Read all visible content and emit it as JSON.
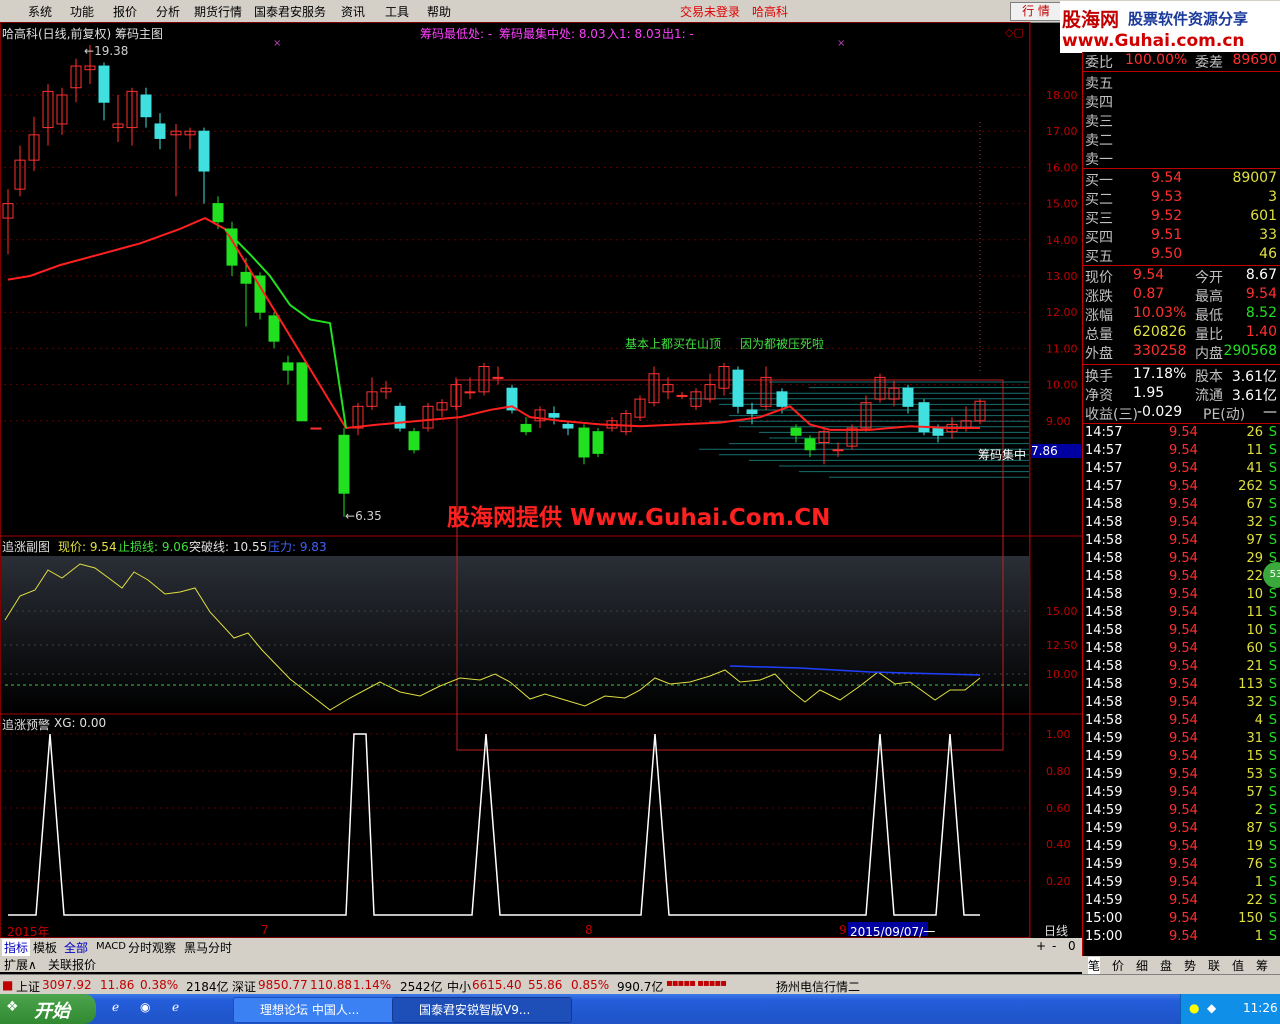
{
  "menu": {
    "items": [
      "系统",
      "功能",
      "报价",
      "分析",
      "期货行情",
      "国泰君安服务",
      "资讯",
      "工具",
      "帮助"
    ],
    "warn_login": "交易未登录",
    "stock_name": "哈高科",
    "btn_hq": "行 情"
  },
  "logo": {
    "title": "股海网",
    "subtitle": "股票软件资源分享",
    "url": "www.Guhai.com.cn"
  },
  "main": {
    "title": "哈高科(日线,前复权) 筹码主图",
    "chip_low": "筹码最低处: -",
    "chip_mid": "筹码最集中处: 8.03",
    "chip_in": "入1: 8.03",
    "chip_out": "出1: -",
    "high_label": "19.38",
    "low_label": "6.35",
    "note1": "基本上都买在山顶",
    "note2": "因为都被压死啦",
    "watermark": "股海网提供 Www.Guhai.Com.CN",
    "chip_center": "筹码集中",
    "chip_center_val": "7.86",
    "yticks": [
      "18.00",
      "17.00",
      "16.00",
      "15.00",
      "14.00",
      "13.00",
      "12.00",
      "11.00",
      "10.00",
      "9.00"
    ]
  },
  "sub1": {
    "title": "追涨副图",
    "price": "现价: 9.54",
    "stop": "止损线: 9.06",
    "breakout": "突破线: 10.55",
    "pressure": "压力: 9.83",
    "yticks": [
      "15.00",
      "12.50",
      "10.00"
    ]
  },
  "sub2": {
    "title": "追涨预警",
    "xg": "XG: 0.00",
    "yticks": [
      "1.00",
      "0.80",
      "0.60",
      "0.40",
      "0.20"
    ]
  },
  "xaxis": {
    "labels": [
      "2015年",
      "7",
      "8",
      "9"
    ],
    "cursor_date": "2015/09/07/一",
    "period": "日线"
  },
  "tabs": [
    "指标",
    "模板",
    "全部",
    "MACD",
    "分时观察",
    "黑马分时"
  ],
  "ext": [
    "扩展∧",
    "关联报价"
  ],
  "order": {
    "ratio_label": "委比",
    "ratio_val": "100.00%",
    "diff_label": "委差",
    "diff_val": "89690",
    "sells": [
      "卖五",
      "卖四",
      "卖三",
      "卖二",
      "卖一"
    ],
    "buys": [
      {
        "name": "买一",
        "price": "9.54",
        "vol": "89007"
      },
      {
        "name": "买二",
        "price": "9.53",
        "vol": "3"
      },
      {
        "name": "买三",
        "price": "9.52",
        "vol": "601"
      },
      {
        "name": "买四",
        "price": "9.51",
        "vol": "33"
      },
      {
        "name": "买五",
        "price": "9.50",
        "vol": "46"
      }
    ]
  },
  "quote": [
    {
      "l": "现价",
      "v": "9.54",
      "l2": "今开",
      "v2": "8.67"
    },
    {
      "l": "涨跌",
      "v": "0.87",
      "l2": "最高",
      "v2": "9.54"
    },
    {
      "l": "涨幅",
      "v": "10.03%",
      "l2": "最低",
      "v2": "8.52"
    },
    {
      "l": "总量",
      "v": "620826",
      "l2": "量比",
      "v2": "1.40"
    },
    {
      "l": "外盘",
      "v": "330258",
      "l2": "内盘",
      "v2": "290568"
    }
  ],
  "fund": [
    {
      "l": "换手",
      "v": "17.18%",
      "l2": "股本",
      "v2": "3.61亿"
    },
    {
      "l": "净资",
      "v": "1.95",
      "l2": "流通",
      "v2": "3.61亿"
    },
    {
      "l": "收益(三)",
      "v": "-0.029",
      "l2": "PE(动)",
      "v2": "—"
    }
  ],
  "ticks": [
    {
      "t": "14:57",
      "p": "9.54",
      "v": "26"
    },
    {
      "t": "14:57",
      "p": "9.54",
      "v": "11"
    },
    {
      "t": "14:57",
      "p": "9.54",
      "v": "41"
    },
    {
      "t": "14:57",
      "p": "9.54",
      "v": "262"
    },
    {
      "t": "14:58",
      "p": "9.54",
      "v": "67"
    },
    {
      "t": "14:58",
      "p": "9.54",
      "v": "32"
    },
    {
      "t": "14:58",
      "p": "9.54",
      "v": "97"
    },
    {
      "t": "14:58",
      "p": "9.54",
      "v": "29"
    },
    {
      "t": "14:58",
      "p": "9.54",
      "v": "22"
    },
    {
      "t": "14:58",
      "p": "9.54",
      "v": "10"
    },
    {
      "t": "14:58",
      "p": "9.54",
      "v": "11"
    },
    {
      "t": "14:58",
      "p": "9.54",
      "v": "10"
    },
    {
      "t": "14:58",
      "p": "9.54",
      "v": "60"
    },
    {
      "t": "14:58",
      "p": "9.54",
      "v": "21"
    },
    {
      "t": "14:58",
      "p": "9.54",
      "v": "113"
    },
    {
      "t": "14:58",
      "p": "9.54",
      "v": "32"
    },
    {
      "t": "14:58",
      "p": "9.54",
      "v": "4"
    },
    {
      "t": "14:59",
      "p": "9.54",
      "v": "31"
    },
    {
      "t": "14:59",
      "p": "9.54",
      "v": "15"
    },
    {
      "t": "14:59",
      "p": "9.54",
      "v": "53"
    },
    {
      "t": "14:59",
      "p": "9.54",
      "v": "57"
    },
    {
      "t": "14:59",
      "p": "9.54",
      "v": "2"
    },
    {
      "t": "14:59",
      "p": "9.54",
      "v": "87"
    },
    {
      "t": "14:59",
      "p": "9.54",
      "v": "19"
    },
    {
      "t": "14:59",
      "p": "9.54",
      "v": "76"
    },
    {
      "t": "14:59",
      "p": "9.54",
      "v": "1"
    },
    {
      "t": "14:59",
      "p": "9.54",
      "v": "22"
    },
    {
      "t": "15:00",
      "p": "9.54",
      "v": "150"
    },
    {
      "t": "15:00",
      "p": "9.54",
      "v": "1"
    }
  ],
  "tick_flag": "S",
  "side_badge": "53",
  "rp_tabs": [
    "笔",
    "价",
    "细",
    "盘",
    "势",
    "联",
    "值",
    "筹"
  ],
  "status": {
    "sh_label": "上证",
    "sh_val": "3097.92",
    "sh_chg": "11.86",
    "sh_pct": "0.38%",
    "sh_amt": "2184亿",
    "sz_label": "深证",
    "sz_val": "9850.77",
    "sz_chg": "110.88",
    "sz_pct": "1.14%",
    "sz_amt": "2542亿",
    "zx_label": "中小",
    "zx_val": "6615.40",
    "zx_chg": "55.86",
    "zx_pct": "0.85%",
    "zx_amt": "990.7亿",
    "scroll": "扬州电信行情二"
  },
  "taskbar": {
    "start": "开始",
    "task1": "理想论坛 中国人...",
    "task2": "国泰君安锐智版V9...",
    "clock": "11:26"
  }
}
